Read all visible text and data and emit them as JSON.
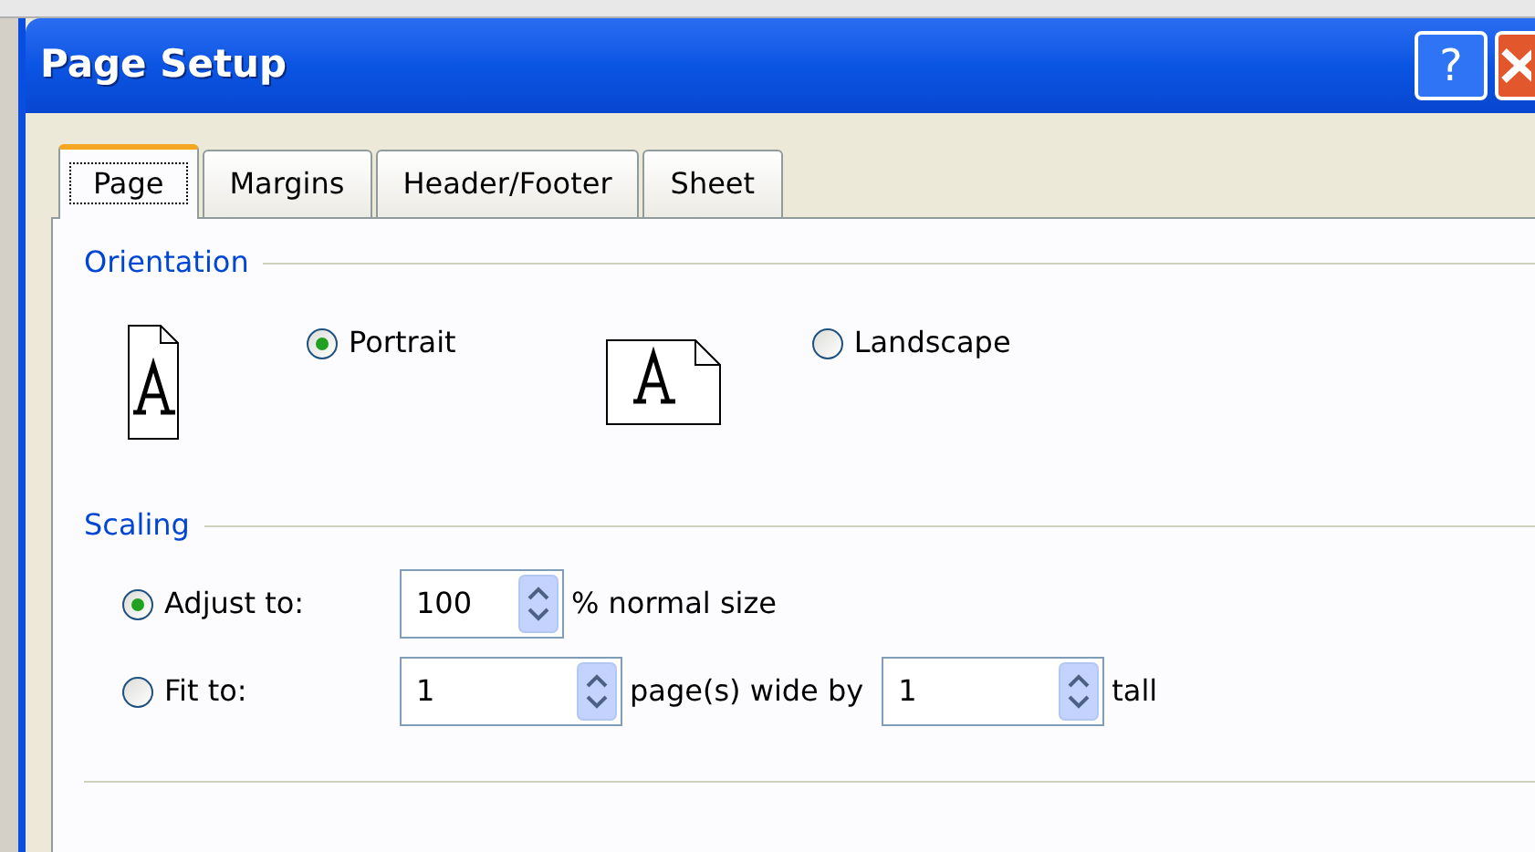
{
  "window": {
    "title": "Page Setup",
    "buttons": [
      {
        "kind": "help",
        "label": "?"
      },
      {
        "kind": "close"
      }
    ]
  },
  "tabs": [
    {
      "label": "Page",
      "selected": true
    },
    {
      "label": "Margins",
      "selected": false
    },
    {
      "label": "Header/Footer",
      "selected": false
    },
    {
      "label": "Sheet",
      "selected": false
    }
  ],
  "orientation": {
    "title": "Orientation",
    "options": [
      {
        "kind": "portrait",
        "label": "Portrait",
        "selected": true
      },
      {
        "kind": "landscape",
        "label": "Landscape",
        "selected": false
      }
    ]
  },
  "scaling": {
    "title": "Scaling",
    "options": [
      {
        "label": "Adjust to:",
        "selected": true,
        "fields": [
          {
            "value": "100",
            "after": "% normal size"
          }
        ]
      },
      {
        "label": "Fit to:",
        "selected": false,
        "fields": [
          {
            "value": "1",
            "after": "page(s) wide by"
          },
          {
            "value": "1",
            "after": "tall"
          }
        ]
      }
    ]
  }
}
